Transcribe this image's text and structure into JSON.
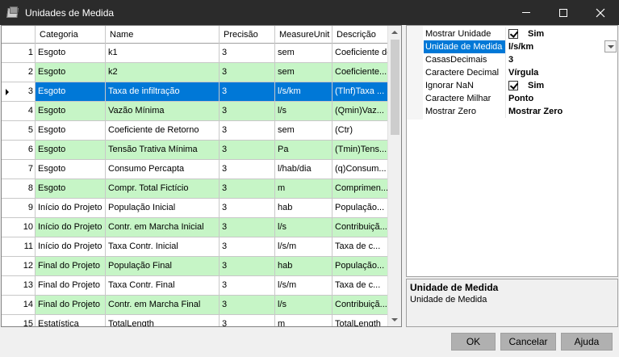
{
  "window": {
    "title": "Unidades de Medida"
  },
  "grid": {
    "columns": [
      "Categoria",
      "Name",
      "Precisão",
      "MeasureUnit",
      "Descrição"
    ],
    "selected_row": 3,
    "rows": [
      {
        "num": "1",
        "cells": [
          "Esgoto",
          "k1",
          "3",
          "sem",
          "Coeficiente de..."
        ]
      },
      {
        "num": "2",
        "cells": [
          "Esgoto",
          "k2",
          "3",
          "sem",
          "Coeficiente..."
        ]
      },
      {
        "num": "3",
        "cells": [
          "Esgoto",
          "Taxa de infiltração",
          "3",
          "l/s/km",
          "(Tlnf)Taxa ..."
        ]
      },
      {
        "num": "4",
        "cells": [
          "Esgoto",
          "Vazão Mínima",
          "3",
          "l/s",
          "(Qmin)Vaz..."
        ]
      },
      {
        "num": "5",
        "cells": [
          "Esgoto",
          "Coeficiente de Retorno",
          "3",
          "sem",
          "(Ctr)"
        ]
      },
      {
        "num": "6",
        "cells": [
          "Esgoto",
          "Tensão Trativa Mínima",
          "3",
          "Pa",
          "(Tmin)Tens..."
        ]
      },
      {
        "num": "7",
        "cells": [
          "Esgoto",
          "Consumo Percapta",
          "3",
          "l/hab/dia",
          "(q)Consum..."
        ]
      },
      {
        "num": "8",
        "cells": [
          "Esgoto",
          "Compr. Total Fictício",
          "3",
          "m",
          "Comprimen..."
        ]
      },
      {
        "num": "9",
        "cells": [
          "Início do Projeto",
          "População Inicial",
          "3",
          "hab",
          "População..."
        ]
      },
      {
        "num": "10",
        "cells": [
          "Início do Projeto",
          "Contr. em Marcha Inicial",
          "3",
          "l/s",
          "Contribuiçã..."
        ]
      },
      {
        "num": "11",
        "cells": [
          "Início do Projeto",
          "Taxa Contr. Inicial",
          "3",
          "l/s/m",
          "Taxa de c..."
        ]
      },
      {
        "num": "12",
        "cells": [
          "Final do Projeto",
          "População Final",
          "3",
          "hab",
          "População..."
        ]
      },
      {
        "num": "13",
        "cells": [
          "Final do Projeto",
          "Taxa Contr. Final",
          "3",
          "l/s/m",
          "Taxa de c..."
        ]
      },
      {
        "num": "14",
        "cells": [
          "Final do Projeto",
          "Contr. em Marcha Final",
          "3",
          "l/s",
          "Contribuiçã..."
        ]
      },
      {
        "num": "15",
        "cells": [
          "Estatística",
          "TotalLength",
          "3",
          "m",
          "TotalLength"
        ]
      }
    ]
  },
  "properties": {
    "items": [
      {
        "label": "Mostrar Unidade",
        "value": "Sim",
        "type": "checkbox"
      },
      {
        "label": "Unidade de Medida",
        "value": "l/s/km",
        "type": "dropdown",
        "selected": true
      },
      {
        "label": "CasasDecimais",
        "value": "3",
        "type": "text"
      },
      {
        "label": "Caractere Decimal",
        "value": "Vírgula",
        "type": "text"
      },
      {
        "label": "Ignorar NaN",
        "value": "Sim",
        "type": "checkbox"
      },
      {
        "label": "Caractere Milhar",
        "value": "Ponto",
        "type": "text"
      },
      {
        "label": "Mostrar Zero",
        "value": "Mostrar Zero",
        "type": "text"
      }
    ]
  },
  "description": {
    "title": "Unidade de Medida",
    "body": "Unidade de Medida"
  },
  "buttons": {
    "ok": "OK",
    "cancel": "Cancelar",
    "help": "Ajuda"
  },
  "colors": {
    "selection": "#0078d7",
    "alt_row": "#c6f5c6",
    "titlebar": "#2b2b2b"
  }
}
